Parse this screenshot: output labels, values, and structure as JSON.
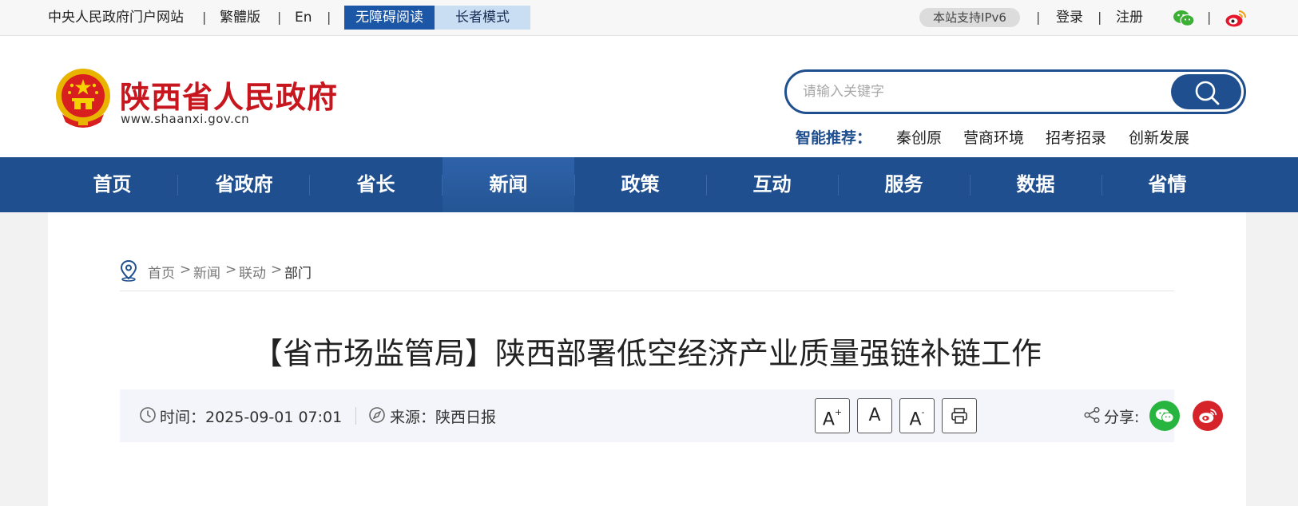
{
  "topbar": {
    "links": [
      "中央人民政府门户网站",
      "繁體版",
      "En"
    ],
    "accessibility_label": "无障碍阅读",
    "elder_mode_label": "长者模式",
    "ipv6_badge": "本站支持IPv6",
    "login_label": "登录",
    "register_label": "注册",
    "separator": "|",
    "icons": [
      "wechat-icon",
      "weibo-icon"
    ]
  },
  "header": {
    "site_title": "陕西省人民政府",
    "site_domain": "www.shaanxi.gov.cn",
    "emblem_icon": "national-emblem-icon",
    "search_placeholder": "请输入关键字",
    "recommend_label": "智能推荐：",
    "recommend_items": [
      "秦创原",
      "营商环境",
      "招考招录",
      "创新发展"
    ]
  },
  "nav": {
    "items": [
      "首页",
      "省政府",
      "省长",
      "新闻",
      "政策",
      "互动",
      "服务",
      "数据",
      "省情"
    ],
    "active": "新闻"
  },
  "breadcrumb": {
    "items": [
      "首页",
      "新闻",
      "联动",
      "部门"
    ],
    "separator": ">"
  },
  "article": {
    "title": "【省市场监管局】陕西部署低空经济产业质量强链补链工作",
    "time": "时间：2025-09-01 07:01",
    "source": "来源：陕西日报",
    "font_controls": [
      "A+",
      "A",
      "A-"
    ],
    "share_label": "分享:"
  },
  "colors": {
    "brand_blue": "#1f4f8f",
    "title_red": "#c8161e",
    "wechat_green": "#27b43f",
    "weibo_red": "#d6232a"
  }
}
